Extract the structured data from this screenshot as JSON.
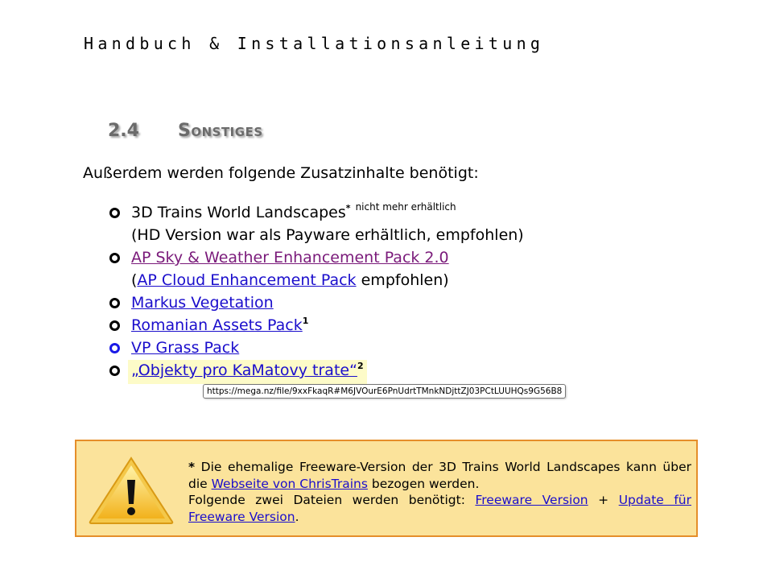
{
  "header": "Handbuch & Installationsanleitung",
  "section": {
    "number": "2.4",
    "title": "Sonstiges"
  },
  "intro": "Außerdem werden folgende Zusatzinhalte benötigt:",
  "items": [
    {
      "text": "3D Trains World Landscapes",
      "star": "*",
      "note": "nicht mehr erhältlich",
      "sub": "(HD Version war als Payware erhältlich, empfohlen)"
    },
    {
      "link": "AP Sky & Weather Enhancement Pack 2.0",
      "sub_open": "(",
      "sub_link": "AP Cloud Enhancement Pack",
      "sub_close": " empfohlen)"
    },
    {
      "link": "Markus Vegetation"
    },
    {
      "link": "Romanian Assets Pack",
      "footnote": "1"
    },
    {
      "link": "VP Grass Pack"
    },
    {
      "link": "„Objekty pro KaMatovy trate“",
      "footnote": "2"
    }
  ],
  "tooltip": "https://mega.nz/file/9xxFkaqR#M6JVOurE6PnUdrtTMnkNDjttZJ03PCtLUUHQs9G56B8",
  "notice": {
    "star": "*",
    "line1_pre": " Die ehemalige Freeware-Version der 3D Trains World Landscapes kann über die ",
    "link_site": "Webseite von ChrisTrains",
    "line1_post": " bezogen werden.",
    "line2_pre": "Folgende zwei Dateien werden benötigt: ",
    "link_freeware": "Freeware Version",
    "plus": " + ",
    "link_update": "Update für Freeware Version",
    "end": "."
  },
  "colors": {
    "link": "#1a0dcc",
    "visited": "#7a1a7a",
    "notice_bg": "#fbe39b",
    "notice_border": "#e58e2a",
    "highlight": "#fdfbc8"
  },
  "icons": {
    "warning": "warning-triangle-icon",
    "bullet": "circle-bullet-icon"
  }
}
